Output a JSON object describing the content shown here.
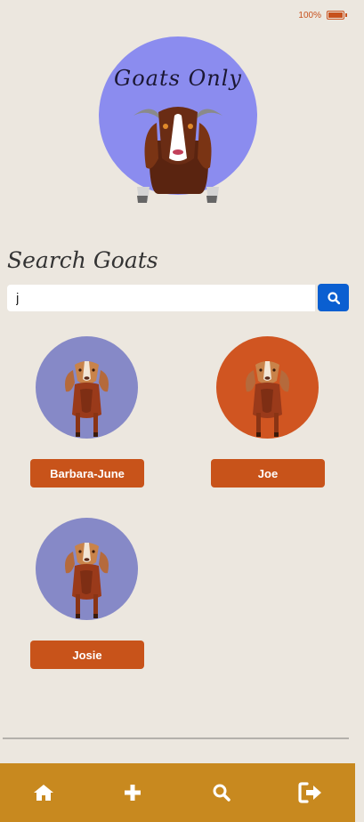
{
  "status_bar": {
    "battery": "100%"
  },
  "logo": {
    "title": "Goats Only"
  },
  "search": {
    "heading": "Search Goats",
    "value": "j",
    "placeholder": ""
  },
  "results": [
    {
      "name": "Barbara-June",
      "avatar_color": "#8689c7"
    },
    {
      "name": "Joe",
      "avatar_color": "#d05521"
    },
    {
      "name": "Josie",
      "avatar_color": "#8689c7"
    }
  ],
  "colors": {
    "background": "#ece7df",
    "accent": "#c8531a",
    "search_button": "#0a5fd1",
    "bottom_nav": "#c8891f",
    "logo_circle": "#8b8cef"
  },
  "bottom_nav": {
    "items": [
      {
        "icon": "home-icon"
      },
      {
        "icon": "plus-icon"
      },
      {
        "icon": "search-icon"
      },
      {
        "icon": "sign-out-icon"
      }
    ]
  }
}
